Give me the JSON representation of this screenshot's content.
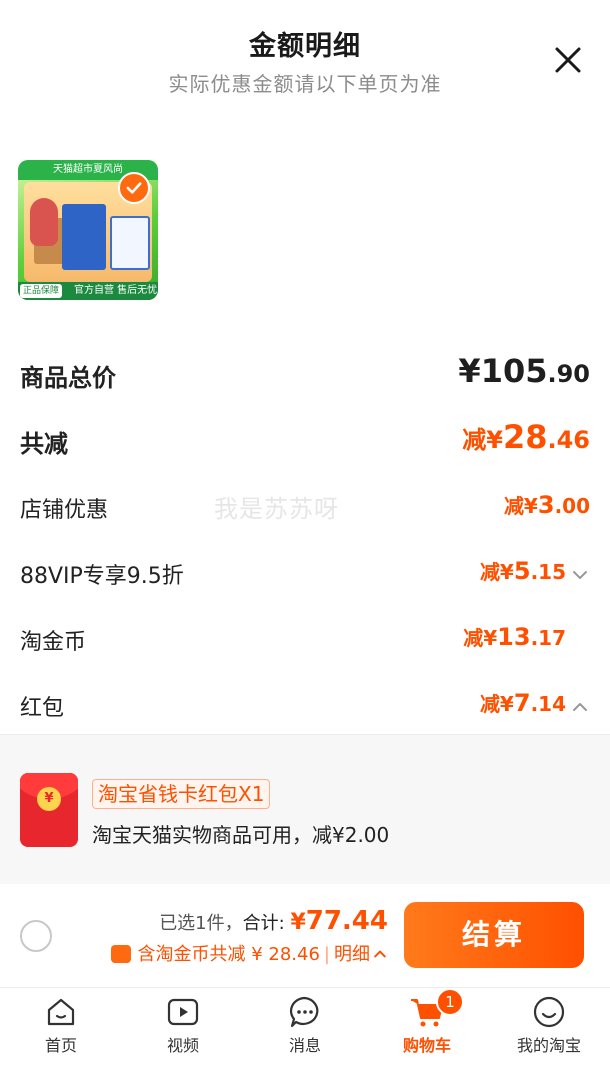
{
  "header": {
    "title": "金额明细",
    "subtitle": "实际优惠金额请以下单页为准"
  },
  "product": {
    "banner_text": "天猫超市夏风尚",
    "guarantee_badge": "正品保障",
    "official_text": "官方自营 售后无忧",
    "selected": true
  },
  "summary": {
    "total_label": "商品总价",
    "total_value_main": "¥105",
    "total_value_dec": ".90",
    "reduce_label": "共减",
    "reduce_value_prefix": "减¥",
    "reduce_value_main": "28",
    "reduce_value_dec": ".46"
  },
  "discounts": [
    {
      "label": "店铺优惠",
      "prefix": "减¥",
      "main": "3",
      "dec": ".00",
      "expand": "none"
    },
    {
      "label": "88VIP专享9.5折",
      "prefix": "减¥",
      "main": "5",
      "dec": ".15",
      "expand": "down"
    },
    {
      "label": "淘金币",
      "prefix": "减¥",
      "main": "13",
      "dec": ".17",
      "expand": "none"
    },
    {
      "label": "红包",
      "prefix": "减¥",
      "main": "7",
      "dec": ".14",
      "expand": "up"
    }
  ],
  "watermark": "我是苏苏呀",
  "red_packet": {
    "coin_symbol": "¥",
    "tag": "淘宝省钱卡红包X1",
    "description": "淘宝天猫实物商品可用，减¥2.00"
  },
  "checkout": {
    "selected_text": "已选1件，",
    "total_label": "合计: ",
    "total_currency": "¥",
    "total_value": "77.44",
    "deduct_text": "含淘金币共减 ¥ 28.46",
    "separator": "|",
    "detail_link": "明细",
    "settle_button": "结算"
  },
  "tabbar": {
    "items": [
      {
        "label": "首页",
        "icon": "home-icon"
      },
      {
        "label": "视频",
        "icon": "video-icon"
      },
      {
        "label": "消息",
        "icon": "message-icon"
      },
      {
        "label": "购物车",
        "icon": "cart-icon",
        "badge": "1",
        "active": true
      },
      {
        "label": "我的淘宝",
        "icon": "profile-icon"
      }
    ]
  },
  "colors": {
    "accent": "#ff5000",
    "muted": "#8c8c8c"
  }
}
